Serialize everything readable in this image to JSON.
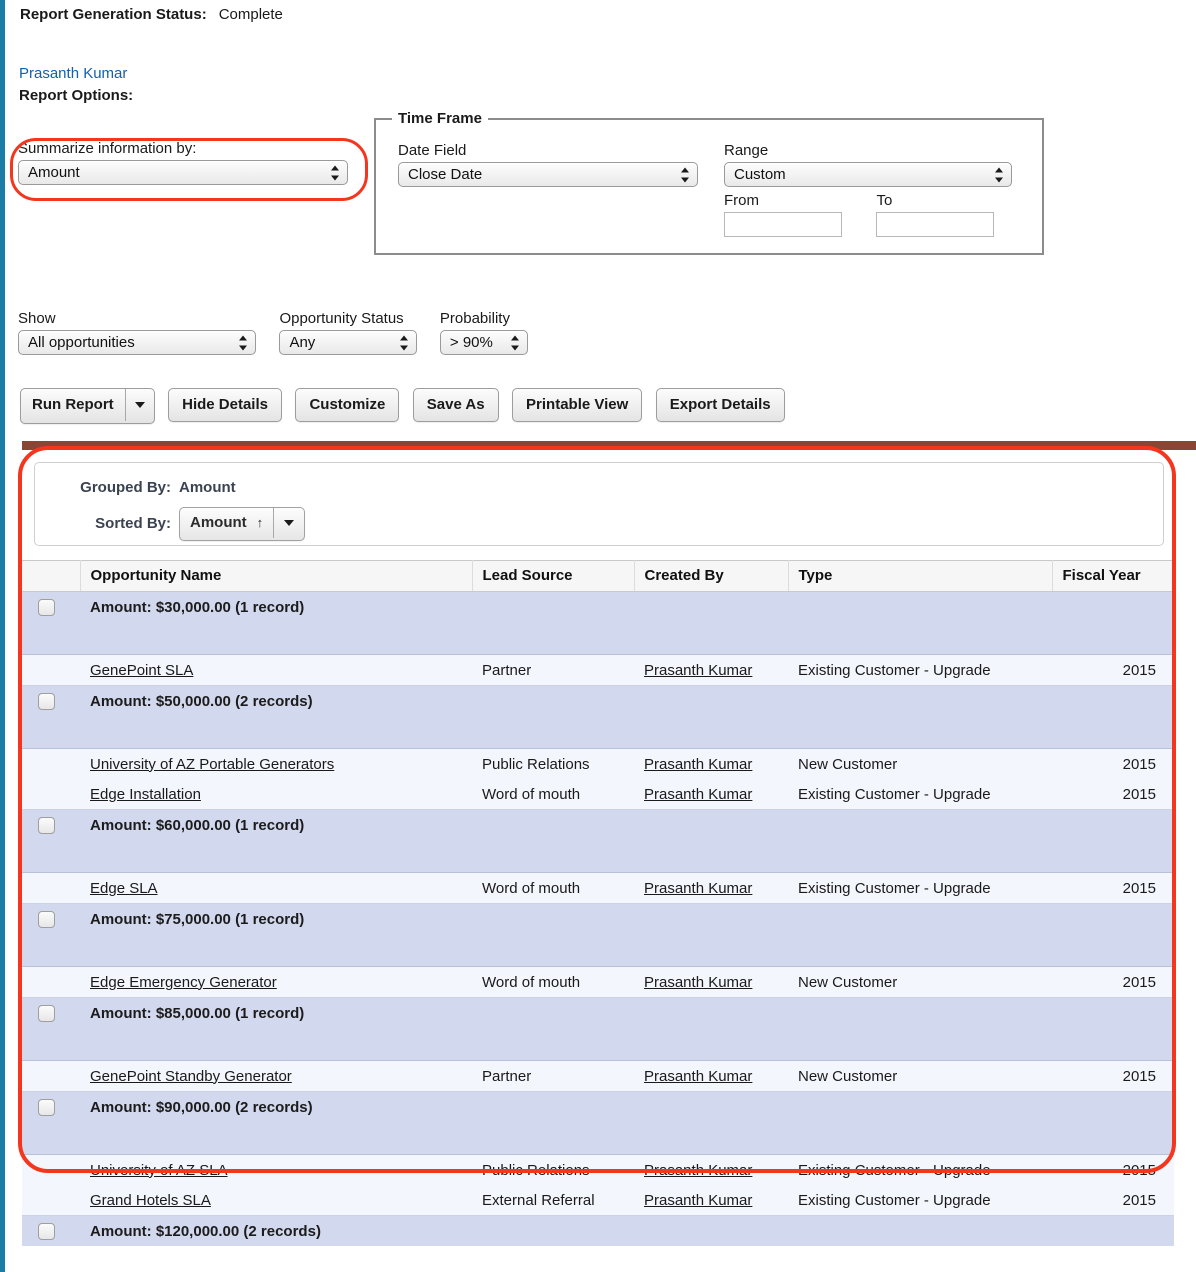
{
  "status": {
    "label": "Report Generation Status:",
    "value": "Complete"
  },
  "owner": {
    "name": "Prasanth Kumar"
  },
  "report_options": {
    "heading": "Report Options:",
    "summarize": {
      "label": "Summarize information by:",
      "value": "Amount"
    }
  },
  "time_frame": {
    "legend": "Time Frame",
    "date_field": {
      "label": "Date Field",
      "value": "Close Date"
    },
    "range": {
      "label": "Range",
      "value": "Custom"
    },
    "from": {
      "label": "From",
      "value": ""
    },
    "to": {
      "label": "To",
      "value": ""
    }
  },
  "filters": {
    "show": {
      "label": "Show",
      "value": "All opportunities"
    },
    "opportunity_status": {
      "label": "Opportunity Status",
      "value": "Any"
    },
    "probability": {
      "label": "Probability",
      "value": "> 90%"
    }
  },
  "toolbar": {
    "run_report": "Run Report",
    "hide_details": "Hide Details",
    "customize": "Customize",
    "save_as": "Save As",
    "printable_view": "Printable View",
    "export_details": "Export Details"
  },
  "report_panel": {
    "grouped_by": {
      "label": "Grouped By:",
      "value": "Amount"
    },
    "sorted_by": {
      "label": "Sorted By:",
      "value": "Amount",
      "direction_glyph": "↑"
    }
  },
  "table": {
    "columns": [
      "Opportunity Name",
      "Lead Source",
      "Created By",
      "Type",
      "Fiscal Year"
    ],
    "groups": [
      {
        "label": "Amount: $30,000.00",
        "count": "(1 record)",
        "rows": [
          {
            "name": "GenePoint SLA",
            "lead_source": "Partner",
            "created_by": "Prasanth Kumar",
            "type": "Existing Customer - Upgrade",
            "fiscal_year": "2015"
          }
        ]
      },
      {
        "label": "Amount: $50,000.00",
        "count": "(2 records)",
        "rows": [
          {
            "name": "University of AZ Portable Generators",
            "lead_source": "Public Relations",
            "created_by": "Prasanth Kumar",
            "type": "New Customer",
            "fiscal_year": "2015"
          },
          {
            "name": "Edge Installation",
            "lead_source": "Word of mouth",
            "created_by": "Prasanth Kumar",
            "type": "Existing Customer - Upgrade",
            "fiscal_year": "2015"
          }
        ]
      },
      {
        "label": "Amount: $60,000.00",
        "count": "(1 record)",
        "rows": [
          {
            "name": "Edge SLA",
            "lead_source": "Word of mouth",
            "created_by": "Prasanth Kumar",
            "type": "Existing Customer - Upgrade",
            "fiscal_year": "2015"
          }
        ]
      },
      {
        "label": "Amount: $75,000.00",
        "count": "(1 record)",
        "rows": [
          {
            "name": "Edge Emergency Generator",
            "lead_source": "Word of mouth",
            "created_by": "Prasanth Kumar",
            "type": "New Customer",
            "fiscal_year": "2015"
          }
        ]
      },
      {
        "label": "Amount: $85,000.00",
        "count": "(1 record)",
        "rows": [
          {
            "name": "GenePoint Standby Generator",
            "lead_source": "Partner",
            "created_by": "Prasanth Kumar",
            "type": "New Customer",
            "fiscal_year": "2015"
          }
        ]
      },
      {
        "label": "Amount: $90,000.00",
        "count": "(2 records)",
        "rows": [
          {
            "name": "University of AZ SLA",
            "lead_source": "Public Relations",
            "created_by": "Prasanth Kumar",
            "type": "Existing Customer - Upgrade",
            "fiscal_year": "2015"
          },
          {
            "name": "Grand Hotels SLA",
            "lead_source": "External Referral",
            "created_by": "Prasanth Kumar",
            "type": "Existing Customer - Upgrade",
            "fiscal_year": "2015"
          }
        ]
      },
      {
        "label": "Amount: $120,000.00",
        "count": "(2 records)",
        "rows": []
      }
    ]
  },
  "colors": {
    "annotation": "#f4361f",
    "link": "#1560a8",
    "rail": "#1b7ca6",
    "panel_top_bar": "#8a4634",
    "group_row": "#d2d9ee",
    "detail_row": "#f4f6fd"
  }
}
